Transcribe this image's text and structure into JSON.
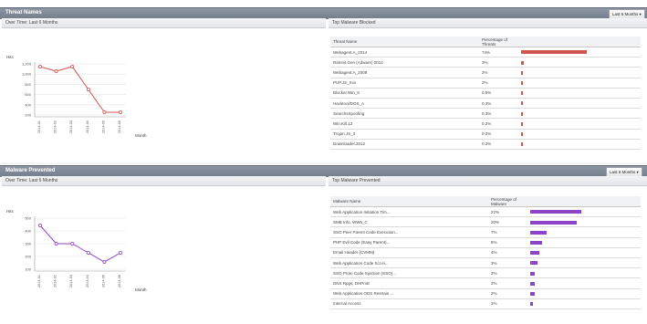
{
  "panel1": {
    "title": "Threat Names",
    "range_label": "Last 6 Months",
    "left_title": "Over Time: Last 6 Months",
    "right_title": "Top Malware Blocked",
    "color": "#d2544f",
    "chart_data": {
      "type": "line",
      "x": [
        "2014-01",
        "2014-02",
        "2014-03",
        "2014-04",
        "2014-05",
        "2014-06"
      ],
      "y": [
        11,
        10,
        11,
        6,
        1,
        1
      ],
      "ylim": [
        0,
        12
      ],
      "yticks": [
        "1,200",
        "1,000",
        "800",
        "600",
        "400",
        "200"
      ],
      "y_unit": "Hits",
      "xlabel": "Month"
    },
    "table": {
      "col1": "Threat Name",
      "col2": "Percentage of Threats",
      "rows": [
        {
          "name": "Webagent.A_2014",
          "pct": "74%",
          "v": 74
        },
        {
          "name": "Ramnit.Gen (Adware) 2014",
          "pct": "3%",
          "v": 3
        },
        {
          "name": "Webagent.A_2008",
          "pct": "2%",
          "v": 2
        },
        {
          "name": "PUP.JS_Xxx",
          "pct": "2%",
          "v": 2
        },
        {
          "name": "Blocker.Win_8",
          "pct": "0.5%",
          "v": 0.5
        },
        {
          "name": "Hacktool/DOS_A",
          "pct": "0.3%",
          "v": 0.3
        },
        {
          "name": "SearchsSpoofing",
          "pct": "0.3%",
          "v": 0.3
        },
        {
          "name": "Win.Kill.12",
          "pct": "0.2%",
          "v": 0.2
        },
        {
          "name": "Trojan.JS_3",
          "pct": "0.2%",
          "v": 0.2
        },
        {
          "name": "Downloader.2012",
          "pct": "0.2%",
          "v": 0.2
        }
      ]
    }
  },
  "panel2": {
    "title": "Malware Prevented",
    "range_label": "Last 6 Months",
    "left_title": "Over Time: Last 6 Months",
    "right_title": "Top Malware Prevented",
    "color": "#8e44c9",
    "chart_data": {
      "type": "line",
      "x": [
        "2014-01",
        "2014-02",
        "2014-03",
        "2014-04",
        "2014-05",
        "2014-06"
      ],
      "y": [
        10,
        6,
        6,
        4,
        2,
        4
      ],
      "ylim": [
        0,
        12
      ],
      "yticks": [
        "500",
        "400",
        "300",
        "200",
        "100"
      ],
      "y_unit": "Hits",
      "xlabel": "Month"
    },
    "table": {
      "col1": "Malware Name",
      "col2": "Percentage of Malware",
      "rows": [
        {
          "name": "Web Application Initiation Tim...",
          "pct": "22%",
          "v": 22
        },
        {
          "name": "SMB Info, WW6_C",
          "pct": "20%",
          "v": 20
        },
        {
          "name": "SSO Peer Parent Code Execution...",
          "pct": "7%",
          "v": 7
        },
        {
          "name": "PHP Evil Code (Easy Parent)...",
          "pct": "5%",
          "v": 5
        },
        {
          "name": "Email Header (CVMM)",
          "pct": "4%",
          "v": 4
        },
        {
          "name": "Web Application Code Scr.ei...",
          "pct": "3%",
          "v": 3
        },
        {
          "name": "SSO Proto Code Injection (SSO)...",
          "pct": "2%",
          "v": 2
        },
        {
          "name": "DNS Rpgs, DHPrxE",
          "pct": "2%",
          "v": 2
        },
        {
          "name": "Web Application ODS Restrain ...",
          "pct": "2%",
          "v": 2
        },
        {
          "name": "Internal Access",
          "pct": "1%",
          "v": 1
        }
      ]
    }
  }
}
